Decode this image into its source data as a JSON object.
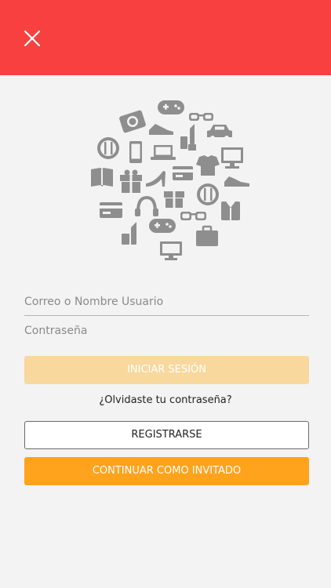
{
  "colors": {
    "header": "#f94040",
    "background": "#f3f3f3",
    "login_button": "#f8d89d",
    "guest_button": "#fea31b",
    "icon_gray": "#8e8e8e"
  },
  "header": {
    "close_icon": "close-icon"
  },
  "illustration": {
    "icon": "shopping-categories-icon-cluster"
  },
  "form": {
    "username_placeholder": "Correo o Nombre Usuario",
    "password_placeholder": "Contraseña"
  },
  "actions": {
    "login_label": "INICIAR SESIÓN",
    "forgot_label": "¿Olvidaste tu contraseña?",
    "register_label": "REGISTRARSE",
    "guest_label": "CONTINUAR COMO INVITADO"
  }
}
